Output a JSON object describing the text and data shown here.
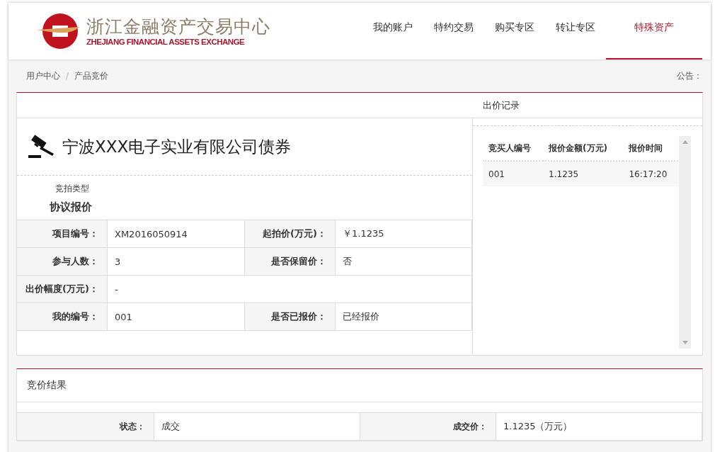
{
  "header": {
    "logo": {
      "name_cn": "浙江金融资产交易中心",
      "name_en": "ZHEJIANG FINANCIAL ASSETS EXCHANGE"
    },
    "nav": [
      {
        "label": "我的账户",
        "selected": false
      },
      {
        "label": "特约交易",
        "selected": false
      },
      {
        "label": "购买专区",
        "selected": false
      },
      {
        "label": "转让专区",
        "selected": false
      },
      {
        "label": "特殊资产",
        "selected": true
      }
    ]
  },
  "breadcrumb": {
    "items": [
      "用户中心",
      "产品竞价"
    ],
    "separator": "/",
    "notice_label": "公告："
  },
  "bid_panel": {
    "record_title": "出价记录",
    "product_title": "宁波XXX电子实业有限公司债券",
    "auction_type_label": "竞拍类型",
    "auction_type": "协议报价",
    "details": [
      [
        {
          "label": "项目编号：",
          "value": "XM2016050914"
        },
        {
          "label": "起拍价(万元)：",
          "value": "￥1.1235"
        }
      ],
      [
        {
          "label": "参与人数：",
          "value": "3"
        },
        {
          "label": "是否保留价：",
          "value": "否"
        }
      ],
      [
        {
          "label": "出价幅度(万元)：",
          "value": "-"
        }
      ],
      [
        {
          "label": "我的编号：",
          "value": "001"
        },
        {
          "label": "是否已报价：",
          "value": "已经报价"
        }
      ]
    ]
  },
  "bid_records": {
    "columns": [
      "竞买人编号",
      "报价金额(万元)",
      "报价时间"
    ],
    "rows": [
      [
        "001",
        "1.1235",
        "16:17:20"
      ]
    ]
  },
  "result": {
    "title": "竞价结果",
    "details": [
      [
        {
          "label": "状态：",
          "value": "成交"
        },
        {
          "label": "成交价：",
          "value": "1.1235（万元）"
        }
      ]
    ]
  }
}
